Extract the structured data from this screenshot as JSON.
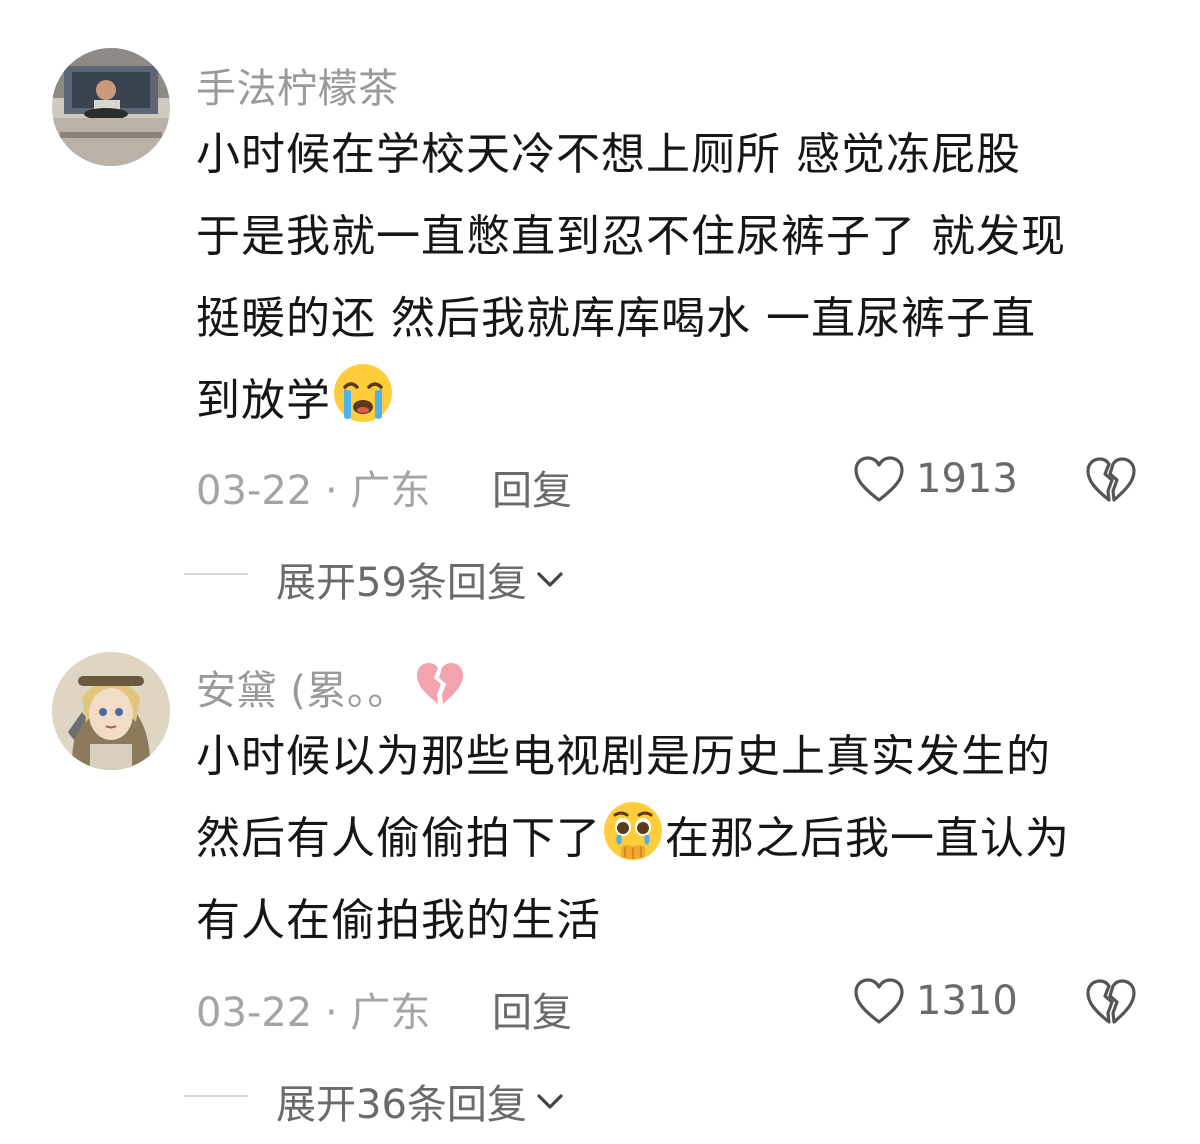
{
  "comments": [
    {
      "username": "手法柠檬茶",
      "avatar_icon": "avatar-driver-photo",
      "body_lines": [
        "小时候在学校天冷不想上厕所 感觉冻屁股",
        "于是我就一直憋直到忍不住尿裤子了 就发现",
        "挺暖的还 然后我就库库喝水 一直尿裤子直",
        "到放学"
      ],
      "emoji": "loudly-crying-face-emoji",
      "date": "03-22",
      "location": "广东",
      "reply_label": "回复",
      "likes": "1913",
      "expand_label": "展开59条回复"
    },
    {
      "username": "安黛 (累。。",
      "username_icon": "broken-heart-icon",
      "avatar_icon": "avatar-anime-girl",
      "body_lines": [
        "小时候以为那些电视剧是历史上真实发生的",
        "然后有人偷偷拍下了",
        "在那之后我一直认为",
        "有人在偷拍我的生活"
      ],
      "emoji": "holding-back-tears-face-emoji",
      "date": "03-22",
      "location": "广东",
      "reply_label": "回复",
      "likes": "1310",
      "expand_label": "展开36条回复"
    }
  ],
  "separator": "·",
  "colors": {
    "text_primary": "#161616",
    "text_secondary": "#9a9a9a",
    "text_action": "#6a6a6a",
    "heart_pink": "#f2a3ad"
  }
}
